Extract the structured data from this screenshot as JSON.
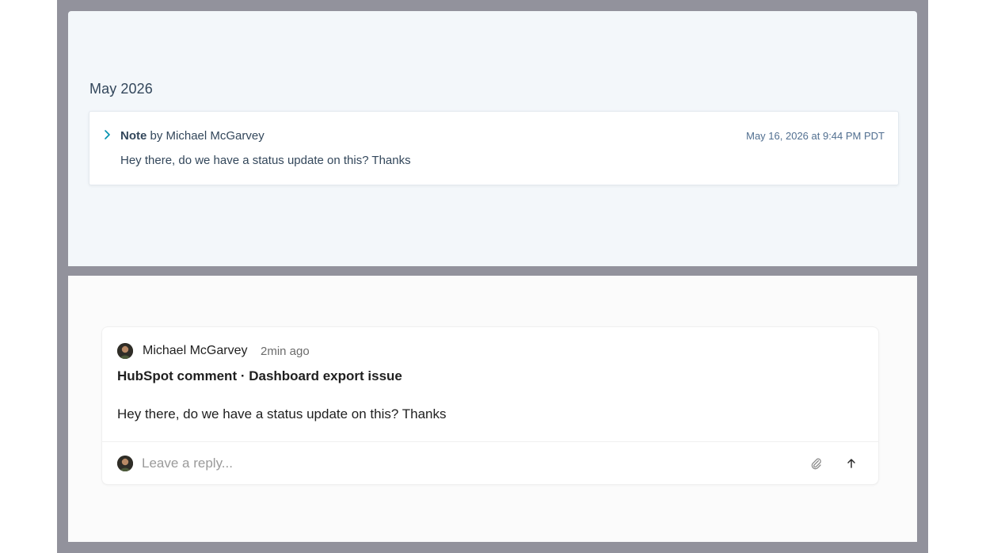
{
  "timeline": {
    "month_heading": "May 2026",
    "note": {
      "type_label": "Note",
      "by_text": " by Michael McGarvey",
      "timestamp": "May 16, 2026 at 9:44 PM PDT",
      "body": "Hey there, do we have a status update on this? Thanks",
      "chevron_icon": "chevron-right-icon",
      "accent_color": "#0091ae"
    }
  },
  "comment": {
    "author": "Michael McGarvey",
    "time_ago": "2min ago",
    "title": "HubSpot comment · Dashboard export issue",
    "body": "Hey there, do we have a status update on this? Thanks",
    "avatar_icon": "user-avatar",
    "reply": {
      "placeholder": "Leave a reply...",
      "value": "",
      "attach_icon": "paperclip-icon",
      "send_icon": "arrow-up-icon"
    }
  }
}
